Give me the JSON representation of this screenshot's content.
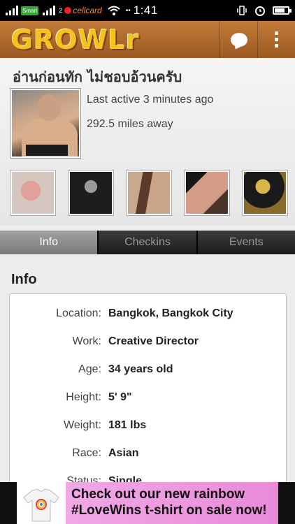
{
  "status_bar": {
    "carrier_1": "Smart",
    "sim_2": "2",
    "carrier_2": "cellcard",
    "time": "1:41",
    "battery_level": 0.7
  },
  "header": {
    "logo": "GROWLr",
    "chat_icon": "chat-bubble-icon",
    "menu_icon": "overflow-menu-icon",
    "bg_color": "#a9642a",
    "logo_color": "#f6c21d"
  },
  "profile": {
    "username": "อ่านก่อนทัก ไม่ชอบอ้วนครับ",
    "last_active": "Last active 3 minutes ago",
    "distance": "292.5 miles away"
  },
  "tabs": [
    {
      "label": "Info",
      "active": true
    },
    {
      "label": "Checkins",
      "active": false
    },
    {
      "label": "Events",
      "active": false
    }
  ],
  "info": {
    "title": "Info",
    "rows": [
      {
        "label": "Location:",
        "value": "Bangkok, Bangkok City"
      },
      {
        "label": "Work:",
        "value": "Creative Director"
      },
      {
        "label": "Age:",
        "value": "34 years old"
      },
      {
        "label": "Height:",
        "value": "5' 9\""
      },
      {
        "label": "Weight:",
        "value": "181 lbs"
      },
      {
        "label": "Race:",
        "value": "Asian"
      },
      {
        "label": "Status:",
        "value": "Single"
      }
    ]
  },
  "ad": {
    "line_1": "Check out our new rainbow",
    "line_2": "#LoveWins t-shirt on sale now!"
  }
}
